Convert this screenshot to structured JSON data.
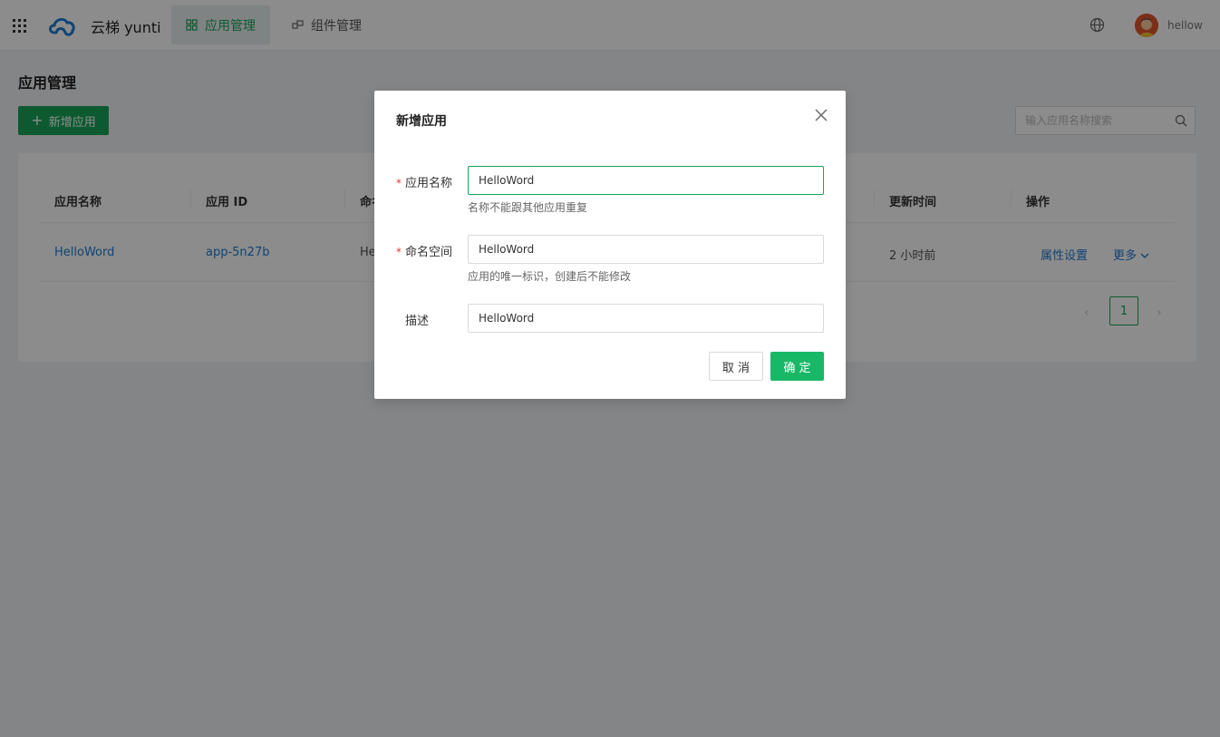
{
  "brand": "云梯 yunti",
  "nav": {
    "tabs": [
      {
        "label": "应用管理",
        "active": true
      },
      {
        "label": "组件管理",
        "active": false
      }
    ]
  },
  "user": {
    "name": "hellow"
  },
  "page": {
    "title": "应用管理",
    "add_button": "新增应用",
    "search_placeholder": "输入应用名称搜索"
  },
  "table": {
    "headers": [
      "应用名称",
      "应用 ID",
      "命名空间",
      "更新时间",
      "操作"
    ],
    "rows": [
      {
        "name": "HelloWord",
        "id": "app-5n27b",
        "namespace_partial": "He",
        "updated": "2 小时前",
        "action_settings": "属性设置",
        "action_more": "更多"
      }
    ]
  },
  "pagination": {
    "current": "1"
  },
  "modal": {
    "title": "新增应用",
    "fields": {
      "name": {
        "label": "应用名称",
        "value": "HelloWord",
        "help": "名称不能跟其他应用重复",
        "required": true
      },
      "namespace": {
        "label": "命名空间",
        "value": "HelloWord",
        "help": "应用的唯一标识，创建后不能修改",
        "required": true
      },
      "description": {
        "label": "描述",
        "value": "HelloWord",
        "required": false
      }
    },
    "cancel_label": "取 消",
    "ok_label": "确 定"
  },
  "colors": {
    "accent": "#19a45a",
    "link": "#1f7ad1",
    "required": "#e53935"
  }
}
